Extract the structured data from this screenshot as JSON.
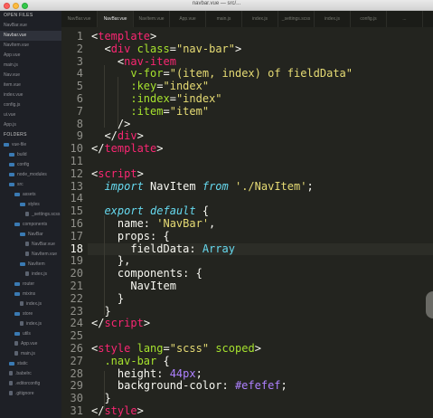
{
  "window": {
    "title": "navbar.vue — src/..."
  },
  "sidebar": {
    "open_files_header": "OPEN FILES",
    "folders_header": "FOLDERS",
    "open_files": [
      "NavBar.vue",
      "Navbar.vue",
      "NavItem.vue",
      "App.vue",
      "main.js",
      "Nav.vue",
      "item.vue",
      "index.vue",
      "config.js",
      "ui.vue",
      "App.js"
    ],
    "tree": [
      {
        "label": "vue-file",
        "kind": "folder",
        "depth": 0
      },
      {
        "label": "build",
        "kind": "folder",
        "depth": 1
      },
      {
        "label": "config",
        "kind": "folder",
        "depth": 1
      },
      {
        "label": "node_modules",
        "kind": "folder",
        "depth": 1
      },
      {
        "label": "src",
        "kind": "folder",
        "depth": 1
      },
      {
        "label": "assets",
        "kind": "folder",
        "depth": 2
      },
      {
        "label": "styles",
        "kind": "folder",
        "depth": 3
      },
      {
        "label": "_settings.scss",
        "kind": "file",
        "depth": 4
      },
      {
        "label": "components",
        "kind": "folder",
        "depth": 2
      },
      {
        "label": "NavBar",
        "kind": "folder",
        "depth": 3
      },
      {
        "label": "NavBar.vue",
        "kind": "file",
        "depth": 4
      },
      {
        "label": "NavItem.vue",
        "kind": "file",
        "depth": 4
      },
      {
        "label": "NavItem",
        "kind": "folder",
        "depth": 3
      },
      {
        "label": "index.js",
        "kind": "file",
        "depth": 4
      },
      {
        "label": "router",
        "kind": "folder",
        "depth": 2
      },
      {
        "label": "mixins",
        "kind": "folder",
        "depth": 2
      },
      {
        "label": "index.js",
        "kind": "file",
        "depth": 3
      },
      {
        "label": "store",
        "kind": "folder",
        "depth": 2
      },
      {
        "label": "index.js",
        "kind": "file",
        "depth": 3
      },
      {
        "label": "utils",
        "kind": "folder",
        "depth": 2
      },
      {
        "label": "App.vue",
        "kind": "file",
        "depth": 2
      },
      {
        "label": "main.js",
        "kind": "file",
        "depth": 2
      },
      {
        "label": "static",
        "kind": "folder",
        "depth": 1
      },
      {
        "label": ".babelrc",
        "kind": "file",
        "depth": 1
      },
      {
        "label": ".editorconfig",
        "kind": "file",
        "depth": 1
      },
      {
        "label": ".gitignore",
        "kind": "file",
        "depth": 1
      }
    ]
  },
  "tabs": [
    {
      "label": "NavBar.vue",
      "active": false
    },
    {
      "label": "NavBar.vue",
      "active": true
    },
    {
      "label": "NavItem.vue",
      "active": false
    },
    {
      "label": "App.vue",
      "active": false
    },
    {
      "label": "main.js",
      "active": false
    },
    {
      "label": "index.js",
      "active": false
    },
    {
      "label": "_settings.scss",
      "active": false
    },
    {
      "label": "index.js",
      "active": false
    },
    {
      "label": "config.js",
      "active": false
    },
    {
      "label": "...",
      "active": false
    }
  ],
  "editor": {
    "current_line": 18,
    "lines": [
      {
        "n": "1",
        "tokens": [
          [
            "t-pun",
            "<"
          ],
          [
            "t-tag",
            "template"
          ],
          [
            "t-pun",
            ">"
          ]
        ]
      },
      {
        "n": "2",
        "tokens": [
          [
            "t-plain",
            "  "
          ],
          [
            "t-pun",
            "<"
          ],
          [
            "t-tag",
            "div"
          ],
          [
            "t-plain",
            " "
          ],
          [
            "t-att",
            "class"
          ],
          [
            "t-pun",
            "="
          ],
          [
            "t-str",
            "\"nav-bar\""
          ],
          [
            "t-pun",
            ">"
          ]
        ]
      },
      {
        "n": "3",
        "tokens": [
          [
            "t-plain",
            "    "
          ],
          [
            "t-pun",
            "<"
          ],
          [
            "t-tag",
            "nav-item"
          ]
        ]
      },
      {
        "n": "4",
        "tokens": [
          [
            "t-plain",
            "      "
          ],
          [
            "t-att",
            "v-for"
          ],
          [
            "t-pun",
            "="
          ],
          [
            "t-str",
            "\"(item, index) of fieldData\""
          ]
        ]
      },
      {
        "n": "5",
        "tokens": [
          [
            "t-plain",
            "      "
          ],
          [
            "t-att",
            ":key"
          ],
          [
            "t-pun",
            "="
          ],
          [
            "t-str",
            "\"index\""
          ]
        ]
      },
      {
        "n": "6",
        "tokens": [
          [
            "t-plain",
            "      "
          ],
          [
            "t-att",
            ":index"
          ],
          [
            "t-pun",
            "="
          ],
          [
            "t-str",
            "\"index\""
          ]
        ]
      },
      {
        "n": "7",
        "tokens": [
          [
            "t-plain",
            "      "
          ],
          [
            "t-att",
            ":item"
          ],
          [
            "t-pun",
            "="
          ],
          [
            "t-str",
            "\"item\""
          ]
        ]
      },
      {
        "n": "8",
        "tokens": [
          [
            "t-plain",
            "    "
          ],
          [
            "t-pun",
            "/>"
          ]
        ]
      },
      {
        "n": "9",
        "tokens": [
          [
            "t-plain",
            "  "
          ],
          [
            "t-pun",
            "</"
          ],
          [
            "t-tag",
            "div"
          ],
          [
            "t-pun",
            ">"
          ]
        ]
      },
      {
        "n": "10",
        "tokens": [
          [
            "t-pun",
            "</"
          ],
          [
            "t-tag",
            "template"
          ],
          [
            "t-pun",
            ">"
          ]
        ]
      },
      {
        "n": "11",
        "tokens": []
      },
      {
        "n": "12",
        "tokens": [
          [
            "t-pun",
            "<"
          ],
          [
            "t-tag",
            "script"
          ],
          [
            "t-pun",
            ">"
          ]
        ]
      },
      {
        "n": "13",
        "tokens": [
          [
            "t-plain",
            "  "
          ],
          [
            "t-kw",
            "import"
          ],
          [
            "t-plain",
            " NavItem "
          ],
          [
            "t-kw",
            "from"
          ],
          [
            "t-plain",
            " "
          ],
          [
            "t-str",
            "'./NavItem'"
          ],
          [
            "t-pun",
            ";"
          ]
        ]
      },
      {
        "n": "14",
        "tokens": []
      },
      {
        "n": "15",
        "tokens": [
          [
            "t-plain",
            "  "
          ],
          [
            "t-kw",
            "export"
          ],
          [
            "t-plain",
            " "
          ],
          [
            "t-kw",
            "default"
          ],
          [
            "t-plain",
            " {"
          ]
        ]
      },
      {
        "n": "16",
        "tokens": [
          [
            "t-plain",
            "    name: "
          ],
          [
            "t-str",
            "'NavBar'"
          ],
          [
            "t-pun",
            ","
          ]
        ]
      },
      {
        "n": "17",
        "tokens": [
          [
            "t-plain",
            "    props: {"
          ]
        ]
      },
      {
        "n": "18",
        "tokens": [
          [
            "t-plain",
            "      fieldData: "
          ],
          [
            "t-fn",
            "Array"
          ]
        ]
      },
      {
        "n": "19",
        "tokens": [
          [
            "t-plain",
            "    },"
          ]
        ]
      },
      {
        "n": "20",
        "tokens": [
          [
            "t-plain",
            "    components: {"
          ]
        ]
      },
      {
        "n": "21",
        "tokens": [
          [
            "t-plain",
            "      NavItem"
          ]
        ]
      },
      {
        "n": "22",
        "tokens": [
          [
            "t-plain",
            "    }"
          ]
        ]
      },
      {
        "n": "23",
        "tokens": [
          [
            "t-plain",
            "  }"
          ]
        ]
      },
      {
        "n": "24",
        "tokens": [
          [
            "t-pun",
            "</"
          ],
          [
            "t-tag",
            "script"
          ],
          [
            "t-pun",
            ">"
          ]
        ]
      },
      {
        "n": "25",
        "tokens": []
      },
      {
        "n": "26",
        "tokens": [
          [
            "t-pun",
            "<"
          ],
          [
            "t-tag",
            "style"
          ],
          [
            "t-plain",
            " "
          ],
          [
            "t-att",
            "lang"
          ],
          [
            "t-pun",
            "="
          ],
          [
            "t-str",
            "\"scss\""
          ],
          [
            "t-plain",
            " "
          ],
          [
            "t-att",
            "scoped"
          ],
          [
            "t-pun",
            ">"
          ]
        ]
      },
      {
        "n": "27",
        "tokens": [
          [
            "t-plain",
            "  "
          ],
          [
            "t-att",
            ".nav-bar"
          ],
          [
            "t-plain",
            " {"
          ]
        ]
      },
      {
        "n": "28",
        "tokens": [
          [
            "t-plain",
            "    height: "
          ],
          [
            "t-num",
            "44px"
          ],
          [
            "t-pun",
            ";"
          ]
        ]
      },
      {
        "n": "29",
        "tokens": [
          [
            "t-plain",
            "    background-color: "
          ],
          [
            "t-num",
            "#efefef"
          ],
          [
            "t-pun",
            ";"
          ]
        ]
      },
      {
        "n": "30",
        "tokens": [
          [
            "t-plain",
            "  }"
          ]
        ]
      },
      {
        "n": "31",
        "tokens": [
          [
            "t-pun",
            "</"
          ],
          [
            "t-tag",
            "style"
          ],
          [
            "t-pun",
            ">"
          ]
        ]
      }
    ]
  }
}
